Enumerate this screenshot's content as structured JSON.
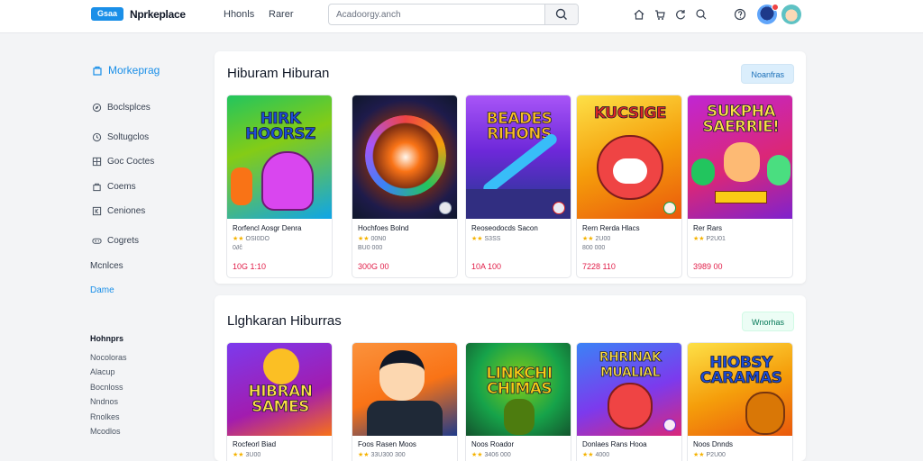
{
  "header": {
    "logo_badge": "Gsaa",
    "logo_text": "Nprkeplace",
    "nav": [
      "Hhonls",
      "Rarer"
    ],
    "search_placeholder": "Acadoorgy.anch",
    "icons": [
      "home-icon",
      "cart-icon",
      "refresh-icon",
      "search-icon",
      "help-icon"
    ]
  },
  "sidebar": {
    "title": "Morkeprag",
    "items": [
      {
        "label": "Boclsplces",
        "icon": "compass-icon"
      },
      {
        "label": "Soltugclos",
        "icon": "clock-icon"
      },
      {
        "label": "Goc Coctes",
        "icon": "grid-icon"
      },
      {
        "label": "Coems",
        "icon": "bag-icon"
      },
      {
        "label": "Ceniones",
        "icon": "k-icon"
      },
      {
        "label": "Cogrets",
        "icon": "gamepad-icon"
      }
    ],
    "plain": "Mcnlces",
    "active": "Dame",
    "section_head": "Hohnprs",
    "sub_items": [
      "Nocoloras",
      "Alacup",
      "Bocnloss",
      "Nndnos",
      "Rnolkes",
      "Mcodlos"
    ]
  },
  "sections": [
    {
      "title": "Hiburam Hiburan",
      "button": "Noanfras",
      "cards": [
        {
          "art": "HIRK HOORSZ",
          "name": "Rorfencl Aosgr Denra",
          "meta": "OSI0DO",
          "extra": "0∂ĉ",
          "price": "10G 1:10",
          "palette": "green"
        },
        {
          "art": "",
          "name": "Hochfoes Bolnd",
          "meta": "00N0",
          "extra": "BU0 000",
          "price": "300G 00",
          "palette": "vortex"
        },
        {
          "art": "BEADES RIHONS",
          "name": "Reoseodocds Sacon",
          "meta": "S3SS",
          "extra": "",
          "price": "10A 100",
          "palette": "purple"
        },
        {
          "art": "KUCSIGE",
          "name": "Rern Rerda Hlacs",
          "meta": "2U00",
          "extra": "800 000",
          "price": "7228 110",
          "palette": "yellow"
        },
        {
          "art": "SUKPHA SAERRIE!",
          "name": "Rer Rars",
          "meta": "P2U01",
          "extra": "",
          "price": "3989 00",
          "palette": "magenta"
        }
      ]
    },
    {
      "title": "Llghkaran Hiburras",
      "button": "Wnorhas",
      "cards": [
        {
          "art": "HIBRAN SAMES",
          "name": "Rocfeorl Biad",
          "meta": "3U00",
          "extra": "",
          "price": "",
          "palette": "purple2"
        },
        {
          "art": "",
          "name": "Foos Rasen Moos",
          "meta": "33U300 300",
          "extra": "",
          "price": "",
          "palette": "orange"
        },
        {
          "art": "LINKCHI CHIMAS",
          "name": "Noos Roador",
          "meta": "3406 000",
          "extra": "",
          "price": "",
          "palette": "green2"
        },
        {
          "art": "RHRINAK MUALIAL",
          "name": "Donlaes Rans Hooa",
          "meta": "4000",
          "extra": "",
          "price": "",
          "palette": "blue"
        },
        {
          "art": "HIOBSY CARAMAS",
          "name": "Noos Dnnds",
          "meta": "P2U00",
          "extra": "",
          "price": "",
          "palette": "yellow2"
        }
      ]
    }
  ]
}
